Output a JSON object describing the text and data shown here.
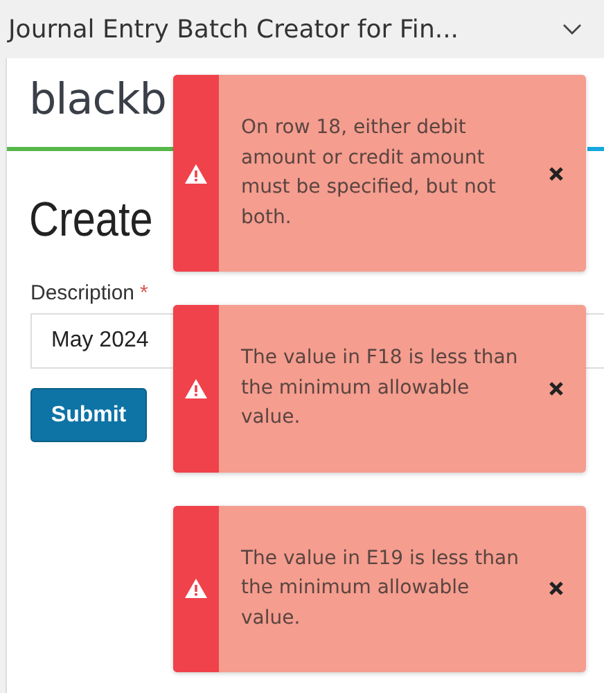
{
  "window": {
    "title": "Journal Entry Batch Creator for Fin..."
  },
  "page": {
    "logo": "blackb",
    "heading": "Create",
    "form": {
      "label": "Description",
      "required_mark": "*",
      "value": "May 2024"
    },
    "submit": "Submit"
  },
  "toasts": [
    {
      "kind": "error",
      "message": "On row 18, either debit amount or credit amount must be specified, but not both."
    },
    {
      "kind": "error",
      "message": "The value in F18 is less than the minimum allowable value."
    },
    {
      "kind": "error",
      "message": "The value in E19 is less than the minimum allowable value."
    }
  ]
}
